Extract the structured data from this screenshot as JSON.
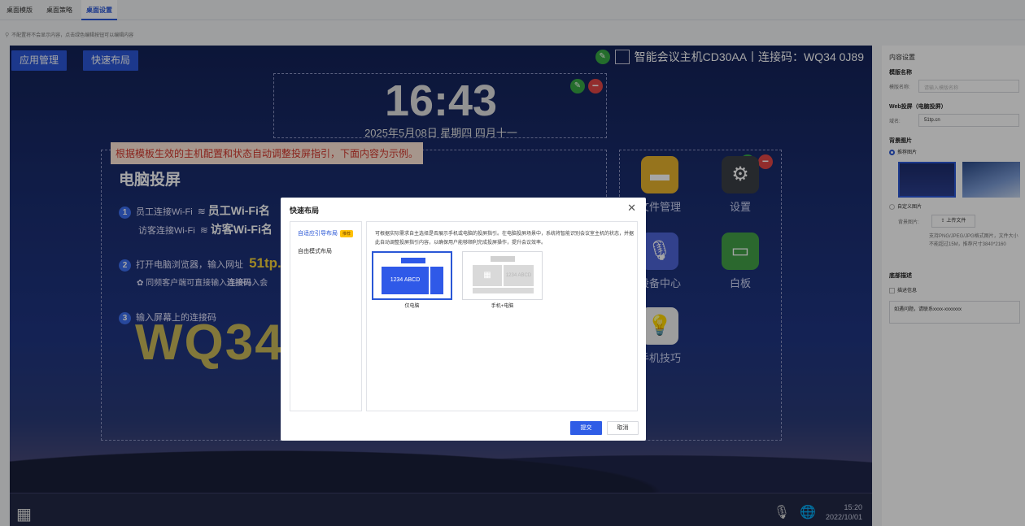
{
  "tabs": [
    {
      "label": "桌面模版",
      "active": false
    },
    {
      "label": "桌面策略",
      "active": false
    },
    {
      "label": "桌面设置",
      "active": true
    }
  ],
  "hint": "不配置将不会显示内容，点击绿色编辑按钮可以编辑内容",
  "stage": {
    "app_mgmt_label": "应用管理",
    "quick_layout_label": "快速布局",
    "device_title": "智能会议主机CD30AA丨连接码：WQ34 0J89",
    "clock": "16:43",
    "date": "2025年5月08日 星期四 四月十一",
    "notice": "根据模板生效的主机配置和状态自动调整投屏指引，下面内容为示例。",
    "pc_title": "电脑投屏",
    "step1_num": "1",
    "step1_staff_prefix": "员工连接Wi-Fi",
    "step1_staff_wifi": "员工Wi-Fi名",
    "step1_guest_prefix": "访客连接Wi-Fi",
    "step1_guest_wifi": "访客Wi-Fi名",
    "step2_num": "2",
    "step2_text": "打开电脑浏览器，输入网址",
    "step2_url": "51tp.cn",
    "step2_sub_prefix": "同频客户端可直接输入",
    "step2_sub_bold": "连接码",
    "step2_sub_suffix": "入会",
    "step3_num": "3",
    "step3_text": "输入屏幕上的连接码",
    "big_code": "WQ34",
    "apps": [
      {
        "label": "文件管理",
        "icon": "folder-icon"
      },
      {
        "label": "设置",
        "icon": "gear-icon"
      },
      {
        "label": "设备中心",
        "icon": "mic-icon"
      },
      {
        "label": "白板",
        "icon": "whiteboard-icon"
      },
      {
        "label": "手机技巧",
        "icon": "bulb-icon"
      }
    ],
    "time": "15:20",
    "date_small": "2022/10/01"
  },
  "modal": {
    "title": "快速布局",
    "menu": [
      {
        "label": "自适应引导布局",
        "badge": "推荐",
        "active": true
      },
      {
        "label": "自由模式布局",
        "active": false
      }
    ],
    "description": "可根据实际需求自主选择是否展示手机或电脑的投屏指引。在电脑投屏场景中，系统将智能识别会议室主机的状态，并据此自动调整投屏指引内容，以确保用户能够顺利完成投屏操作，提升会议效率。",
    "option1_label": "仅电脑",
    "option1_code": "1234 ABCD",
    "option2_label": "手机+电脑",
    "option2_code": "1234 ABCD",
    "submit": "提交",
    "cancel": "取消"
  },
  "panel": {
    "title": "内容设置",
    "template_name_heading": "模版名称",
    "template_name_label": "模版名称:",
    "template_name_placeholder": "请输入模版名称",
    "web_heading": "Web投屏（电脑投屏）",
    "domain_label": "域名:",
    "domain_value": "51tp.cn",
    "bg_heading": "背景图片",
    "recommended_label": "推荐图片",
    "custom_label": "自定义图片",
    "bg_label": "背景图片:",
    "upload_label": "上传文件",
    "upload_note": "支持PNG/JPEG/JPG格式图片，文件大小不能超过15M，推荐尺寸3840*2160",
    "footer_heading": "底部描述",
    "desc_info_label": "描述信息",
    "desc_value": "如遇问题，请联系xxxx-xxxxxxx"
  }
}
